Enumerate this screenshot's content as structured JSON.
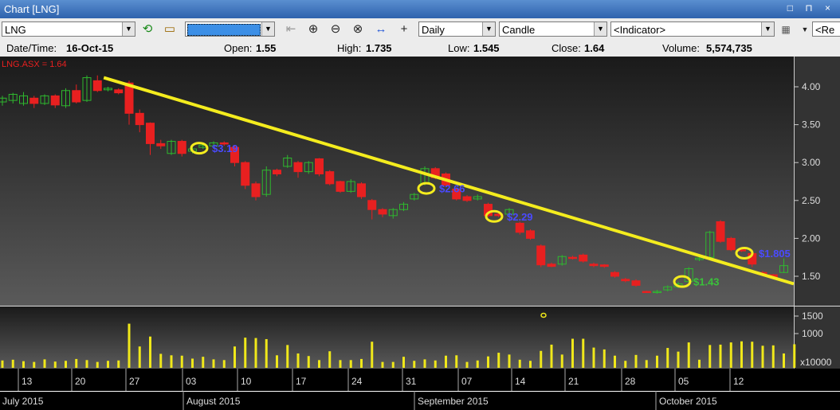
{
  "window": {
    "title": "Chart [LNG]",
    "controls": "□ ⊓ ×"
  },
  "toolbar": {
    "symbol_value": "LNG",
    "period_value": "Daily",
    "chart_type_value": "Candle",
    "indicator_value": "<Indicator>",
    "extra_value": "<Re"
  },
  "info": {
    "date_label": "Date/Time:",
    "date_value": "16-Oct-15",
    "open_label": "Open:",
    "open_value": "1.55",
    "high_label": "High:",
    "high_value": "1.735",
    "low_label": "Low:",
    "low_value": "1.545",
    "close_label": "Close:",
    "close_value": "1.64",
    "volume_label": "Volume:",
    "volume_value": "5,574,735"
  },
  "chart_data": {
    "type": "candlestick",
    "legend": "LNG.ASX = 1.64",
    "price_axis_ticks": [
      "4.00",
      "3.50",
      "3.00",
      "2.50",
      "2.00",
      "1.50"
    ],
    "volume_axis_ticks": [
      "1500",
      "1000"
    ],
    "volume_unit": "x10000",
    "date_ticks": [
      "13",
      "20",
      "27",
      "03",
      "10",
      "17",
      "24",
      "31",
      "07",
      "14",
      "21",
      "28",
      "05",
      "12"
    ],
    "months": [
      "July 2015",
      "August 2015",
      "September 2015",
      "October 2015"
    ],
    "candles": [
      {
        "o": 3.8,
        "c": 3.85,
        "h": 3.88,
        "l": 3.75
      },
      {
        "o": 3.82,
        "c": 3.9,
        "h": 3.92,
        "l": 3.78
      },
      {
        "o": 3.78,
        "c": 3.88,
        "h": 3.93,
        "l": 3.75
      },
      {
        "o": 3.85,
        "c": 3.78,
        "h": 3.88,
        "l": 3.72
      },
      {
        "o": 3.78,
        "c": 3.88,
        "h": 3.9,
        "l": 3.76
      },
      {
        "o": 3.88,
        "c": 3.76,
        "h": 3.9,
        "l": 3.72
      },
      {
        "o": 3.75,
        "c": 3.95,
        "h": 3.98,
        "l": 3.72
      },
      {
        "o": 3.95,
        "c": 3.8,
        "h": 4.03,
        "l": 3.78
      },
      {
        "o": 3.82,
        "c": 4.12,
        "h": 4.15,
        "l": 3.8
      },
      {
        "o": 4.08,
        "c": 3.95,
        "h": 4.15,
        "l": 3.93
      },
      {
        "o": 3.96,
        "c": 3.98,
        "h": 4.0,
        "l": 3.94
      },
      {
        "o": 3.96,
        "c": 3.92,
        "h": 3.98,
        "l": 3.9
      },
      {
        "o": 4.05,
        "c": 3.65,
        "h": 4.08,
        "l": 3.5
      },
      {
        "o": 3.65,
        "c": 3.5,
        "h": 3.7,
        "l": 3.4
      },
      {
        "o": 3.52,
        "c": 3.25,
        "h": 3.53,
        "l": 3.1
      },
      {
        "o": 3.25,
        "c": 3.22,
        "h": 3.3,
        "l": 3.18
      },
      {
        "o": 3.12,
        "c": 3.28,
        "h": 3.3,
        "l": 3.1
      },
      {
        "o": 3.28,
        "c": 3.12,
        "h": 3.3,
        "l": 3.08
      },
      {
        "o": 3.15,
        "c": 3.18,
        "h": 3.2,
        "l": 3.12
      },
      {
        "o": 3.2,
        "c": 3.23,
        "h": 3.25,
        "l": 3.18
      },
      {
        "o": 3.22,
        "c": 3.26,
        "h": 3.28,
        "l": 3.2
      },
      {
        "o": 3.26,
        "c": 3.25,
        "h": 3.28,
        "l": 3.22
      },
      {
        "o": 3.2,
        "c": 3.0,
        "h": 3.22,
        "l": 2.95
      },
      {
        "o": 3.0,
        "c": 2.7,
        "h": 3.02,
        "l": 2.65
      },
      {
        "o": 2.72,
        "c": 2.55,
        "h": 2.75,
        "l": 2.5
      },
      {
        "o": 2.58,
        "c": 2.9,
        "h": 2.95,
        "l": 2.55
      },
      {
        "o": 2.9,
        "c": 2.85,
        "h": 2.92,
        "l": 2.82
      },
      {
        "o": 2.95,
        "c": 3.06,
        "h": 3.1,
        "l": 2.93
      },
      {
        "o": 3.0,
        "c": 2.88,
        "h": 3.02,
        "l": 2.8
      },
      {
        "o": 2.88,
        "c": 3.0,
        "h": 3.02,
        "l": 2.85
      },
      {
        "o": 3.05,
        "c": 2.85,
        "h": 3.06,
        "l": 2.82
      },
      {
        "o": 2.88,
        "c": 2.72,
        "h": 2.9,
        "l": 2.7
      },
      {
        "o": 2.75,
        "c": 2.62,
        "h": 2.76,
        "l": 2.6
      },
      {
        "o": 2.62,
        "c": 2.75,
        "h": 2.78,
        "l": 2.6
      },
      {
        "o": 2.72,
        "c": 2.55,
        "h": 2.74,
        "l": 2.52
      },
      {
        "o": 2.5,
        "c": 2.38,
        "h": 2.52,
        "l": 2.25
      },
      {
        "o": 2.38,
        "c": 2.32,
        "h": 2.4,
        "l": 2.28
      },
      {
        "o": 2.3,
        "c": 2.38,
        "h": 2.4,
        "l": 2.26
      },
      {
        "o": 2.38,
        "c": 2.45,
        "h": 2.48,
        "l": 2.36
      },
      {
        "o": 2.52,
        "c": 2.58,
        "h": 2.6,
        "l": 2.5
      },
      {
        "o": 2.72,
        "c": 2.92,
        "h": 2.95,
        "l": 2.7
      },
      {
        "o": 2.92,
        "c": 2.8,
        "h": 2.94,
        "l": 2.78
      },
      {
        "o": 2.85,
        "c": 2.7,
        "h": 2.87,
        "l": 2.68
      },
      {
        "o": 2.65,
        "c": 2.52,
        "h": 2.67,
        "l": 2.5
      },
      {
        "o": 2.55,
        "c": 2.5,
        "h": 2.57,
        "l": 2.48
      },
      {
        "o": 2.52,
        "c": 2.55,
        "h": 2.58,
        "l": 2.5
      },
      {
        "o": 2.45,
        "c": 2.3,
        "h": 2.47,
        "l": 2.28
      },
      {
        "o": 2.32,
        "c": 2.3,
        "h": 2.34,
        "l": 2.28
      },
      {
        "o": 2.32,
        "c": 2.38,
        "h": 2.4,
        "l": 2.3
      },
      {
        "o": 2.2,
        "c": 2.08,
        "h": 2.22,
        "l": 2.05
      },
      {
        "o": 2.1,
        "c": 2.0,
        "h": 2.12,
        "l": 1.98
      },
      {
        "o": 1.9,
        "c": 1.65,
        "h": 1.92,
        "l": 1.62
      },
      {
        "o": 1.66,
        "c": 1.63,
        "h": 1.68,
        "l": 1.62
      },
      {
        "o": 1.66,
        "c": 1.76,
        "h": 1.78,
        "l": 1.64
      },
      {
        "o": 1.75,
        "c": 1.74,
        "h": 1.77,
        "l": 1.72
      },
      {
        "o": 1.78,
        "c": 1.7,
        "h": 1.8,
        "l": 1.68
      },
      {
        "o": 1.66,
        "c": 1.64,
        "h": 1.68,
        "l": 1.62
      },
      {
        "o": 1.65,
        "c": 1.63,
        "h": 1.66,
        "l": 1.61
      },
      {
        "o": 1.55,
        "c": 1.5,
        "h": 1.57,
        "l": 1.48
      },
      {
        "o": 1.46,
        "c": 1.44,
        "h": 1.48,
        "l": 1.42
      },
      {
        "o": 1.44,
        "c": 1.38,
        "h": 1.46,
        "l": 1.36
      },
      {
        "o": 1.3,
        "c": 1.29,
        "h": 1.31,
        "l": 1.28
      },
      {
        "o": 1.29,
        "c": 1.3,
        "h": 1.32,
        "l": 1.27
      },
      {
        "o": 1.32,
        "c": 1.36,
        "h": 1.38,
        "l": 1.3
      },
      {
        "o": 1.36,
        "c": 1.4,
        "h": 1.43,
        "l": 1.34
      },
      {
        "o": 1.43,
        "c": 1.6,
        "h": 1.62,
        "l": 1.42
      },
      {
        "o": 1.72,
        "c": 1.74,
        "h": 1.76,
        "l": 1.7
      },
      {
        "o": 1.75,
        "c": 2.08,
        "h": 2.1,
        "l": 1.73
      },
      {
        "o": 2.22,
        "c": 1.96,
        "h": 2.24,
        "l": 1.94
      },
      {
        "o": 2.0,
        "c": 1.85,
        "h": 2.02,
        "l": 1.83
      },
      {
        "o": 1.85,
        "c": 1.84,
        "h": 1.86,
        "l": 1.82
      },
      {
        "o": 1.8,
        "c": 1.66,
        "h": 1.82,
        "l": 1.62
      },
      {
        "o": 1.55,
        "c": 1.52,
        "h": 1.57,
        "l": 1.5
      },
      {
        "o": 1.52,
        "c": 1.48,
        "h": 1.53,
        "l": 1.46
      },
      {
        "o": 1.55,
        "c": 1.64,
        "h": 1.735,
        "l": 1.545
      }
    ],
    "volume_bars": [
      200,
      220,
      180,
      160,
      230,
      170,
      190,
      240,
      210,
      160,
      190,
      200,
      1200,
      580,
      850,
      380,
      340,
      330,
      250,
      300,
      230,
      210,
      580,
      820,
      810,
      780,
      340,
      620,
      390,
      320,
      210,
      450,
      210,
      210,
      240,
      710,
      160,
      160,
      300,
      190,
      230,
      200,
      330,
      340,
      160,
      200,
      310,
      410,
      360,
      220,
      190,
      460,
      630,
      360,
      790,
      790,
      550,
      500,
      330,
      190,
      350,
      210,
      330,
      540,
      440,
      690,
      220,
      620,
      630,
      690,
      720,
      710,
      600,
      610,
      390,
      640
    ],
    "annotations": [
      {
        "label": "$3.19",
        "price": 3.19,
        "color": "#4a4aff"
      },
      {
        "label": "$2.66",
        "price": 2.66,
        "color": "#4a4aff"
      },
      {
        "label": "$2.29",
        "price": 2.29,
        "color": "#4a4aff"
      },
      {
        "label": "$1.43",
        "price": 1.43,
        "color": "#3ac23a"
      },
      {
        "label": "$1.805",
        "price": 1.805,
        "color": "#4a4aff"
      }
    ],
    "trendline_color": "#f4ec1e",
    "up_color": "#2eb82e",
    "down_color": "#e82020"
  }
}
